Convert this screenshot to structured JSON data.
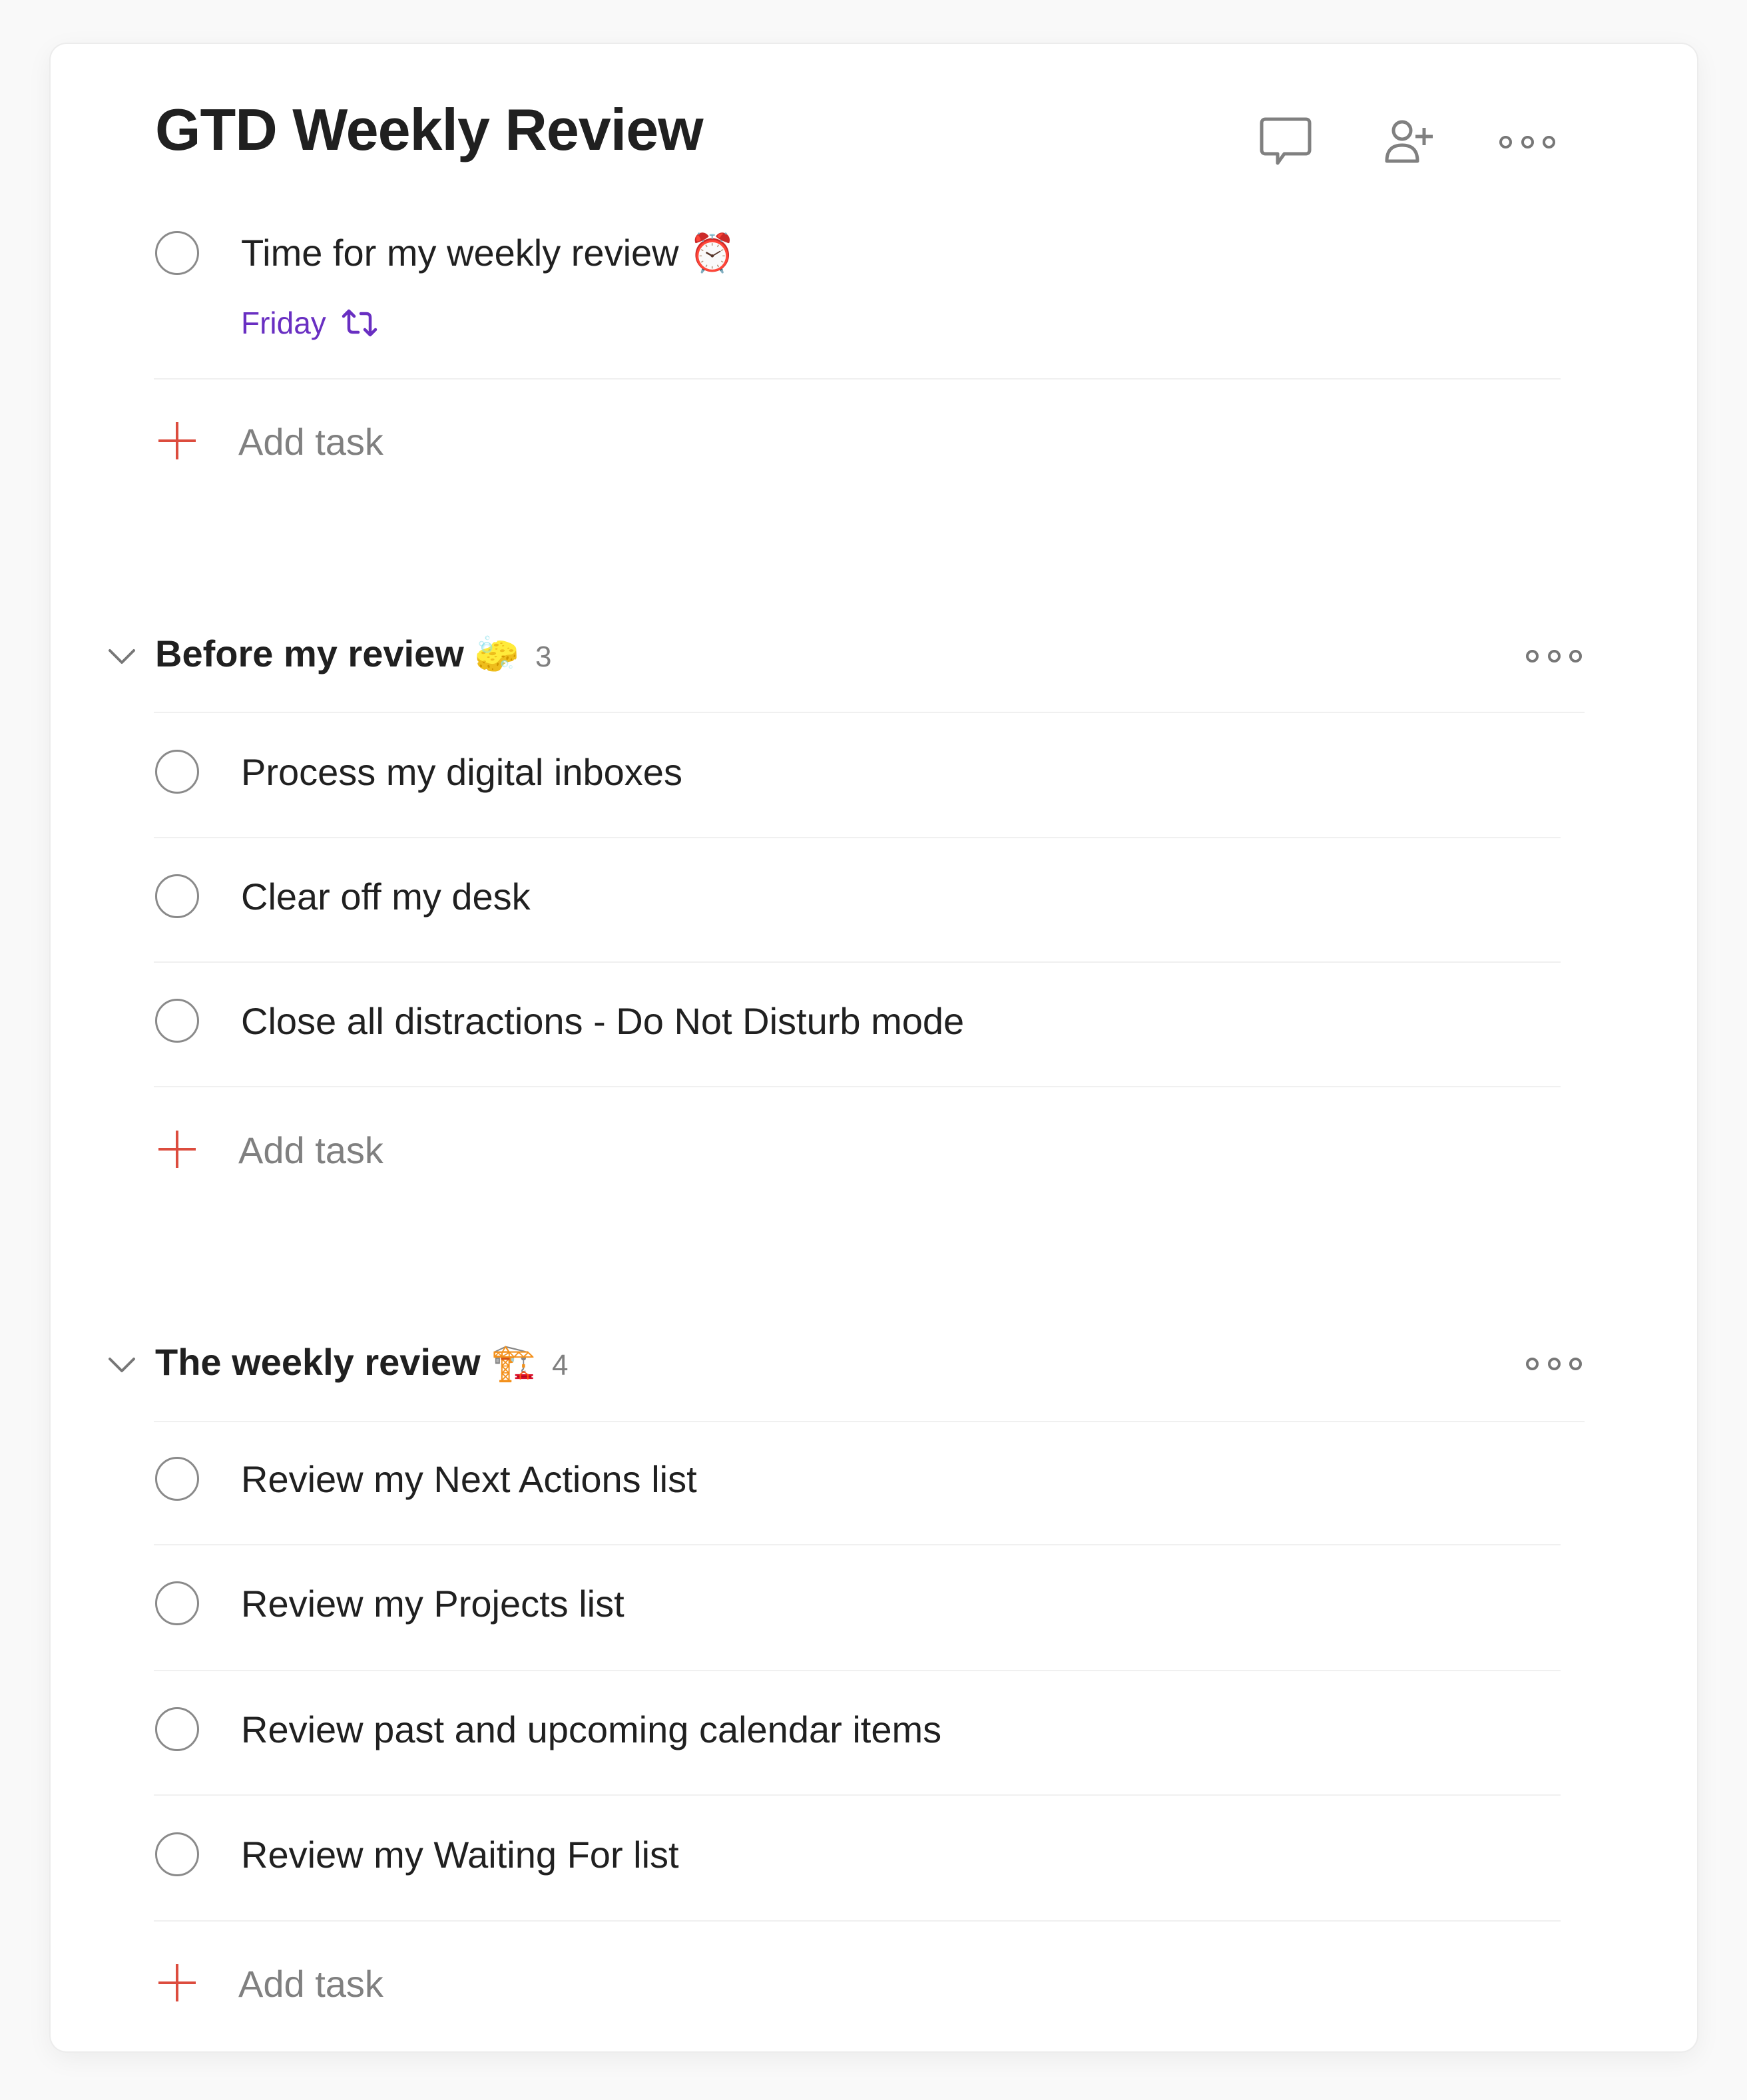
{
  "project": {
    "title": "GTD Weekly Review",
    "header_actions": [
      {
        "icon": "comment-icon",
        "label": "Comments"
      },
      {
        "icon": "add-person-icon",
        "label": "Share"
      },
      {
        "icon": "more-icon",
        "label": "More actions"
      }
    ]
  },
  "colors": {
    "accent_red": "#dc4c3e",
    "due_purple": "#692fc2",
    "text": "#202020",
    "muted": "#808080"
  },
  "root_tasks": [
    {
      "text": "Time for my weekly review ⏰",
      "due": "Friday",
      "recurring": true,
      "recurring_icon": "repeat-icon"
    }
  ],
  "add_task_label": "Add task",
  "sections": [
    {
      "title": "Before my review",
      "emoji": "🧽",
      "count": "3",
      "tasks": [
        {
          "text": "Process my digital inboxes"
        },
        {
          "text": "Clear off my desk"
        },
        {
          "text": "Close all distractions - Do Not Disturb mode"
        }
      ]
    },
    {
      "title": "The weekly review",
      "emoji": "🏗️",
      "count": "4",
      "tasks": [
        {
          "text": "Review my Next Actions list"
        },
        {
          "text": "Review my Projects list"
        },
        {
          "text": "Review past and upcoming calendar items"
        },
        {
          "text": "Review my Waiting For list"
        }
      ]
    }
  ]
}
